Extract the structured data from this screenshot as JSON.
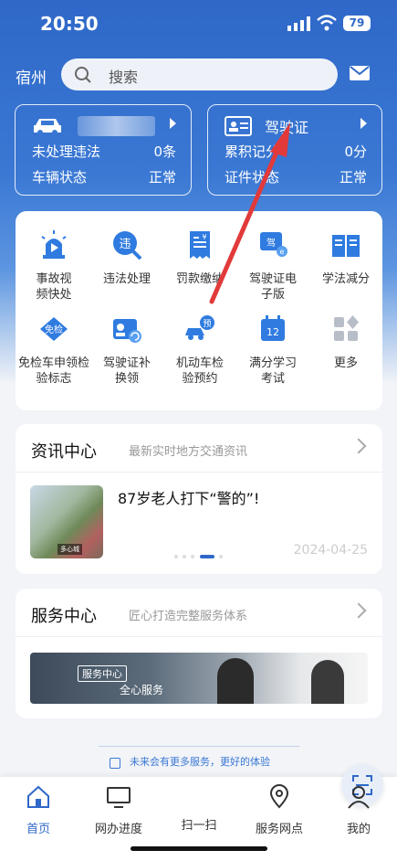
{
  "status_bar": {
    "time": "20:50",
    "battery": "79"
  },
  "header": {
    "city": "宿州",
    "search_placeholder": "搜索"
  },
  "vehicle_card": {
    "row1_label": "未处理违法",
    "row1_value": "0条",
    "row2_label": "车辆状态",
    "row2_value": "正常"
  },
  "license_card": {
    "title": "驾驶证",
    "row1_label": "累积记分",
    "row1_value": "0分",
    "row2_label": "证件状态",
    "row2_value": "正常"
  },
  "services": [
    {
      "label": "事故视频快处",
      "icon": "alarm-light-icon"
    },
    {
      "label": "违法处理",
      "icon": "violation-search-icon"
    },
    {
      "label": "罚款缴纳",
      "icon": "fine-receipt-icon"
    },
    {
      "label": "驾驶证电子版",
      "icon": "e-license-icon"
    },
    {
      "label": "学法减分",
      "icon": "open-book-icon"
    },
    {
      "label": "免检车申领检验标志",
      "icon": "exempt-badge-icon"
    },
    {
      "label": "驾驶证补换领",
      "icon": "license-renew-icon"
    },
    {
      "label": "机动车检验预约",
      "icon": "inspection-booking-icon"
    },
    {
      "label": "满分学习考试",
      "icon": "calendar-12-icon"
    },
    {
      "label": "更多",
      "icon": "more-grid-icon"
    }
  ],
  "news": {
    "title": "资讯中心",
    "subtitle": "最新实时地方交通资讯",
    "headline": "87岁老人打下“警的”!",
    "date": "2024-04-25",
    "thumb_tag": "多心城"
  },
  "service_center": {
    "title": "服务中心",
    "subtitle": "匠心打造完整服务体系",
    "banner_tag": "服务中心",
    "banner_sub": "全心服务"
  },
  "footnote": "未来会有更多服务，更好的体验",
  "tabs": [
    {
      "label": "首页",
      "icon": "home-icon"
    },
    {
      "label": "网办进度",
      "icon": "monitor-icon"
    },
    {
      "label": "扫一扫",
      "icon": "scan-icon"
    },
    {
      "label": "服务网点",
      "icon": "map-pin-icon"
    },
    {
      "label": "我的",
      "icon": "user-icon"
    }
  ],
  "colors": {
    "primary": "#2f68c8",
    "accent": "#3a78d4",
    "annotation_arrow": "#e23a3a"
  }
}
